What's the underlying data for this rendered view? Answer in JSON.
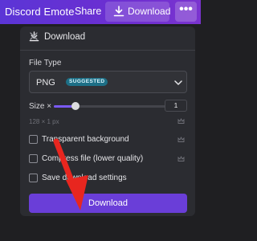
{
  "topbar": {
    "design_title": "Discord Emote",
    "share_label": "Share",
    "download_label": "Download",
    "more_label": "•••"
  },
  "panel": {
    "title": "Download",
    "file_type_label": "File Type",
    "file_type_value": "PNG",
    "file_type_badge": "SUGGESTED",
    "size_label": "Size ×",
    "size_value": "1",
    "dimensions": "128 × 1   px",
    "options": [
      {
        "label": "Transparent background"
      },
      {
        "label": "Compress file (lower quality)"
      },
      {
        "label": "Save download settings"
      }
    ],
    "download_button": "Download"
  },
  "colors": {
    "topbar": "#5b35d6",
    "accent": "#6a3ed8",
    "arrow": "#e8261f",
    "badge": "#1d6f86"
  },
  "icons": [
    "download-icon",
    "close-icon",
    "chevron-down-icon",
    "crown-icon",
    "more-icon"
  ]
}
